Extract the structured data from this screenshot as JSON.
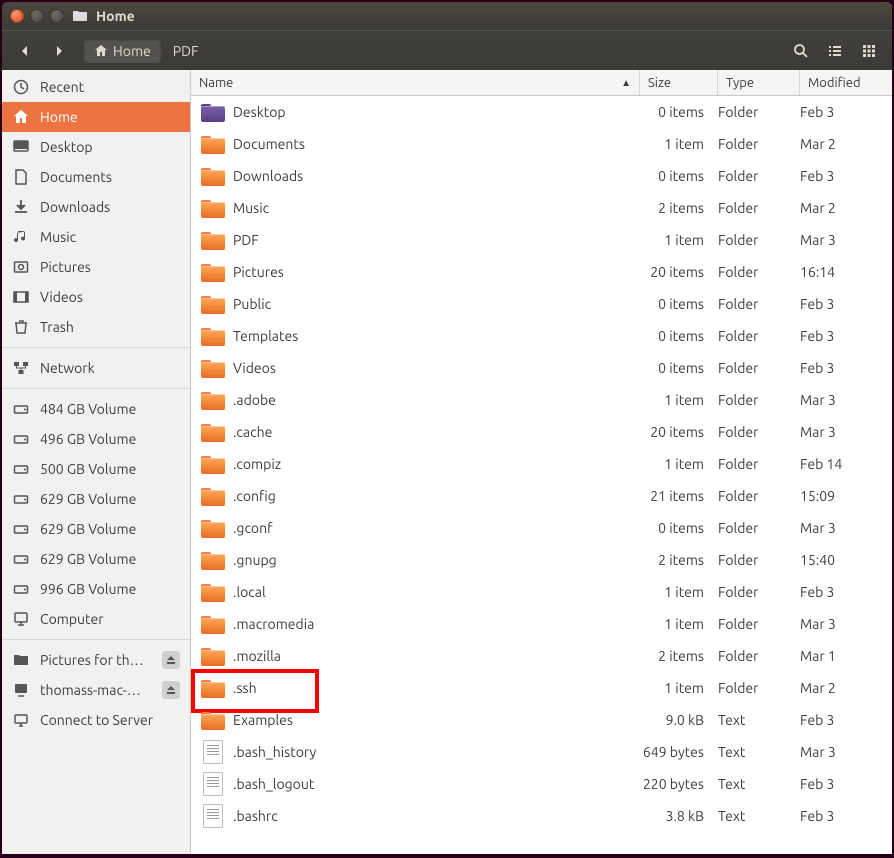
{
  "window": {
    "title": "Home"
  },
  "path": {
    "current": "Home",
    "segments": [
      "PDF"
    ]
  },
  "sidebar": {
    "places": [
      {
        "label": "Recent",
        "icon": "clock"
      },
      {
        "label": "Home",
        "icon": "home",
        "active": true
      },
      {
        "label": "Desktop",
        "icon": "desktop"
      },
      {
        "label": "Documents",
        "icon": "document"
      },
      {
        "label": "Downloads",
        "icon": "downloads"
      },
      {
        "label": "Music",
        "icon": "music"
      },
      {
        "label": "Pictures",
        "icon": "pictures"
      },
      {
        "label": "Videos",
        "icon": "videos"
      },
      {
        "label": "Trash",
        "icon": "trash"
      }
    ],
    "network": [
      {
        "label": "Network",
        "icon": "network"
      }
    ],
    "devices": [
      {
        "label": "484 GB Volume",
        "icon": "drive"
      },
      {
        "label": "496 GB Volume",
        "icon": "drive"
      },
      {
        "label": "500 GB Volume",
        "icon": "drive"
      },
      {
        "label": "629 GB Volume",
        "icon": "drive"
      },
      {
        "label": "629 GB Volume",
        "icon": "drive"
      },
      {
        "label": "629 GB Volume",
        "icon": "drive"
      },
      {
        "label": "996 GB Volume",
        "icon": "drive"
      },
      {
        "label": "Computer",
        "icon": "computer"
      }
    ],
    "other": [
      {
        "label": "Pictures for th…",
        "icon": "folder-remote",
        "eject": true
      },
      {
        "label": "thomass-mac-…",
        "icon": "computer-remote",
        "eject": true
      },
      {
        "label": "Connect to Server",
        "icon": "connect"
      }
    ]
  },
  "columns": {
    "name": "Name",
    "size": "Size",
    "type": "Type",
    "modified": "Modified"
  },
  "files": [
    {
      "name": "Desktop",
      "size": "0 items",
      "type": "Folder",
      "modified": "Feb 3",
      "icon": "folder-desktop"
    },
    {
      "name": "Documents",
      "size": "1 item",
      "type": "Folder",
      "modified": "Mar 2",
      "icon": "folder-docs"
    },
    {
      "name": "Downloads",
      "size": "0 items",
      "type": "Folder",
      "modified": "Feb 3",
      "icon": "folder-dl"
    },
    {
      "name": "Music",
      "size": "2 items",
      "type": "Folder",
      "modified": "Mar 2",
      "icon": "folder-music"
    },
    {
      "name": "PDF",
      "size": "1 item",
      "type": "Folder",
      "modified": "Mar 3",
      "icon": "folder"
    },
    {
      "name": "Pictures",
      "size": "20 items",
      "type": "Folder",
      "modified": "16:14",
      "icon": "folder-pics"
    },
    {
      "name": "Public",
      "size": "0 items",
      "type": "Folder",
      "modified": "Feb 3",
      "icon": "folder-public"
    },
    {
      "name": "Templates",
      "size": "0 items",
      "type": "Folder",
      "modified": "Feb 3",
      "icon": "folder-tmpl"
    },
    {
      "name": "Videos",
      "size": "0 items",
      "type": "Folder",
      "modified": "Feb 3",
      "icon": "folder-vid"
    },
    {
      "name": ".adobe",
      "size": "1 item",
      "type": "Folder",
      "modified": "Mar 3",
      "icon": "folder"
    },
    {
      "name": ".cache",
      "size": "20 items",
      "type": "Folder",
      "modified": "Mar 3",
      "icon": "folder"
    },
    {
      "name": ".compiz",
      "size": "1 item",
      "type": "Folder",
      "modified": "Feb 14",
      "icon": "folder"
    },
    {
      "name": ".config",
      "size": "21 items",
      "type": "Folder",
      "modified": "15:09",
      "icon": "folder"
    },
    {
      "name": ".gconf",
      "size": "0 items",
      "type": "Folder",
      "modified": "Mar 3",
      "icon": "folder"
    },
    {
      "name": ".gnupg",
      "size": "2 items",
      "type": "Folder",
      "modified": "15:40",
      "icon": "folder"
    },
    {
      "name": ".local",
      "size": "1 item",
      "type": "Folder",
      "modified": "Feb 3",
      "icon": "folder"
    },
    {
      "name": ".macromedia",
      "size": "1 item",
      "type": "Folder",
      "modified": "Mar 3",
      "icon": "folder"
    },
    {
      "name": ".mozilla",
      "size": "2 items",
      "type": "Folder",
      "modified": "Mar 1",
      "icon": "folder"
    },
    {
      "name": ".ssh",
      "size": "1 item",
      "type": "Folder",
      "modified": "Mar 2",
      "icon": "folder",
      "highlight": true
    },
    {
      "name": "Examples",
      "size": "9.0 kB",
      "type": "Text",
      "modified": "Feb 3",
      "icon": "folder"
    },
    {
      "name": ".bash_history",
      "size": "649 bytes",
      "type": "Text",
      "modified": "Mar 3",
      "icon": "text"
    },
    {
      "name": ".bash_logout",
      "size": "220 bytes",
      "type": "Text",
      "modified": "Feb 3",
      "icon": "text"
    },
    {
      "name": ".bashrc",
      "size": "3.8 kB",
      "type": "Text",
      "modified": "Feb 3",
      "icon": "text"
    }
  ]
}
